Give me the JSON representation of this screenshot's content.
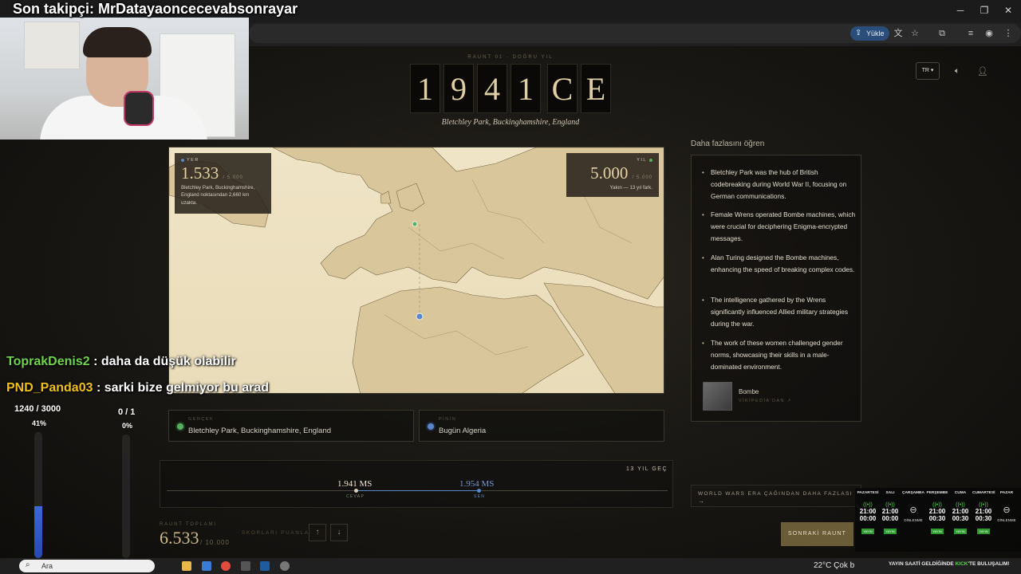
{
  "stream": {
    "follower_text": "Son takipçi: MrDatayaoncecevabsonrayar",
    "chat": [
      {
        "user": "ToprakDenis2",
        "message": " : daha da düşük olabilir"
      },
      {
        "user": "PND_Panda03",
        "message": " : sarki bize gelmiyor bu arad"
      }
    ],
    "goals": [
      {
        "label": "1240 / 3000",
        "percent_text": "41%",
        "fraction": 0.41
      },
      {
        "label": "0 / 1",
        "percent_text": "0%",
        "fraction": 0.0
      }
    ],
    "schedule": [
      {
        "day": "PAZARTESİ",
        "time1": "21:00",
        "time2": "00:00",
        "tag": "YAYIN",
        "off": false
      },
      {
        "day": "SALI",
        "time1": "21:00",
        "time2": "00:00",
        "tag": "YAYIN",
        "off": false
      },
      {
        "day": "ÇARŞAMBA",
        "off": true,
        "off_label": "DİNLENME"
      },
      {
        "day": "PERŞEMBE",
        "time1": "21:00",
        "time2": "00:30",
        "tag": "YAYIN",
        "off": false
      },
      {
        "day": "CUMA",
        "time1": "21:00",
        "time2": "00:30",
        "tag": "YAYIN",
        "off": false
      },
      {
        "day": "CUMARTESİ",
        "time1": "21:00",
        "time2": "00:30",
        "tag": "YAYIN",
        "off": false
      },
      {
        "day": "PAZAR",
        "off": true,
        "off_label": "DİNLENME"
      }
    ],
    "promo_pre": "YAYIN SAATİ GELDİĞİNDE ",
    "promo_brand": "KICK",
    "promo_post": "'TE BULUŞALIM!"
  },
  "browser": {
    "yukle_label": "Yükle"
  },
  "game": {
    "round_meta": "RAUNT 01 · DOĞRU YIL",
    "year_digits": [
      "1",
      "9",
      "4",
      "1"
    ],
    "era_letters": [
      "C",
      "E"
    ],
    "location_title": "Bletchley Park, Buckinghamshire, England",
    "language": "TR",
    "place_card": {
      "tag": "YER",
      "score": "1.533",
      "max": "/ 5.000",
      "note": "Bletchley Park, Buckinghamshire, England noktasından 2,660 km uzakta."
    },
    "year_card": {
      "tag": "YIL",
      "score": "5.000",
      "max": "/ 5.000",
      "note": "Yakın — 13 yıl fark."
    },
    "learn_more_title": "Daha fazlasını öğren",
    "facts": [
      "Bletchley Park was the hub of British codebreaking during World War II, focusing on German communications.",
      "Female Wrens operated Bombe machines, which were crucial for deciphering Enigma-encrypted messages.",
      "Alan Turing designed the Bombe machines, enhancing the speed of breaking complex codes.",
      "The intelligence gathered by the Wrens significantly influenced Allied military strategies during the war.",
      "The work of these women challenged gender norms, showcasing their skills in a male-dominated environment."
    ],
    "wiki": {
      "title": "Bombe",
      "sub": "VİKİPEDİA'DAN ↗"
    },
    "actual": {
      "label": "GERÇEK",
      "value": "Bletchley Park, Buckinghamshire, England"
    },
    "guess": {
      "label": "PİNİN",
      "value": "Bugün Algeria"
    },
    "timeline": {
      "diff": "13 YIL GEÇ",
      "answer_value": "1.941 MS",
      "answer_label": "CEVAP",
      "guess_value": "1.954 MS",
      "guess_label": "SEN"
    },
    "more_era": "WORLD WARS ERA ÇAĞINDAN DAHA FAZLASI",
    "more_arrow": "→",
    "total_label": "RAUNT TOPLAMI",
    "total_value": "6.533",
    "total_max": "/ 10.000",
    "rank_label": "SKORLARI PUANLA",
    "next_label": "SONRAKİ RAUNT"
  },
  "taskbar": {
    "search_text": "Ara",
    "weather": "22°C  Çok b"
  },
  "colors": {
    "accent_gold": "#e0cfa4",
    "guess_blue": "#5a87c9",
    "actual_green": "#57b05e"
  }
}
